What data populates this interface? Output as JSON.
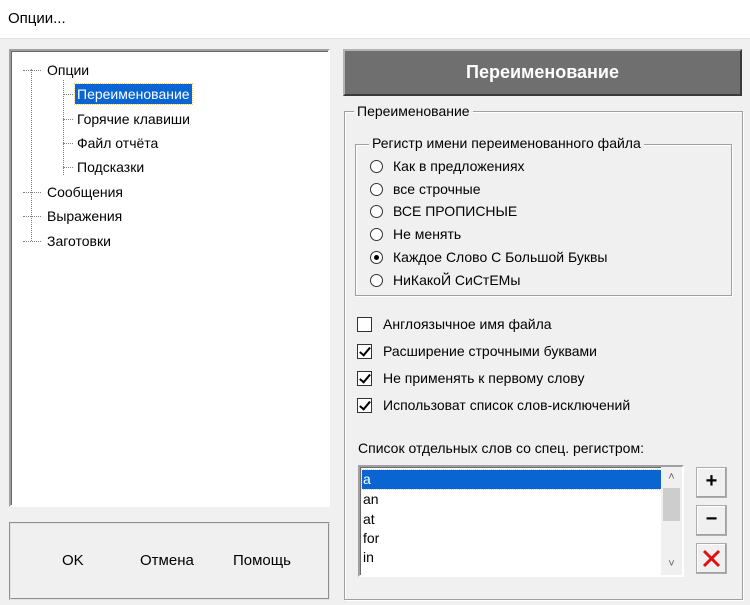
{
  "window": {
    "title": "Опции..."
  },
  "tree": {
    "root": "Опции",
    "children": [
      "Переименование",
      "Горячие клавиши",
      "Файл отчёта",
      "Подсказки"
    ],
    "siblings": [
      "Сообщения",
      "Выражения",
      "Заготовки"
    ],
    "selected": "Переименование"
  },
  "buttons": {
    "ok": "OK",
    "cancel": "Отмена",
    "help": "Помощь"
  },
  "header": {
    "title": "Переименование"
  },
  "rename_group": {
    "legend": "Переименование"
  },
  "case_group": {
    "legend": "Регистр имени переименованного файла",
    "options": [
      {
        "label": "Как в предложениях",
        "selected": false
      },
      {
        "label": "все строчные",
        "selected": false
      },
      {
        "label": "ВСЕ ПРОПИСНЫЕ",
        "selected": false
      },
      {
        "label": "Не менять",
        "selected": false
      },
      {
        "label": "Каждое Слово С Большой Буквы",
        "selected": true
      },
      {
        "label": "НиКакоЙ СиСтЕМы",
        "selected": false
      }
    ]
  },
  "checkboxes": [
    {
      "label": "Англоязычное имя файла",
      "checked": false
    },
    {
      "label": "Расширение строчными буквами",
      "checked": true
    },
    {
      "label": "Не применять к первому слову",
      "checked": true
    },
    {
      "label": "Использоват список слов-исключений",
      "checked": true
    }
  ],
  "word_list": {
    "label": "Список отдельных слов со спец. регистром:",
    "items": [
      "a",
      "an",
      "at",
      "for",
      "in"
    ],
    "selected": "a"
  },
  "list_buttons": {
    "add": "+",
    "remove": "−",
    "delete_icon": "red-x-icon"
  },
  "colors": {
    "selection": "#0a64d2",
    "header_bg": "#6f6f6f",
    "delete": "#e01010"
  }
}
